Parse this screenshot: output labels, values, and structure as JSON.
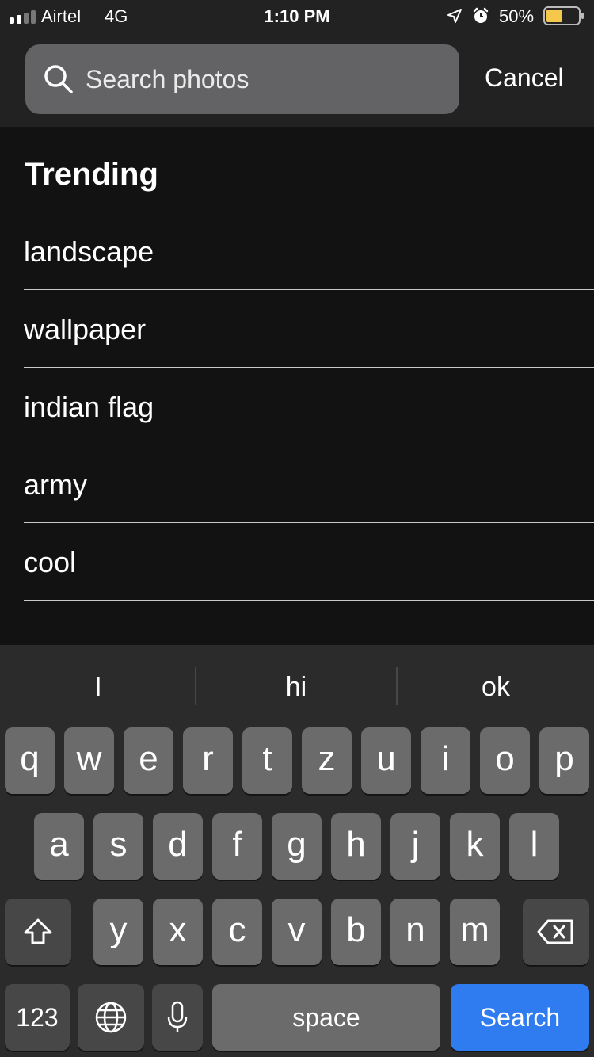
{
  "status_bar": {
    "carrier": "Airtel",
    "network": "4G",
    "time": "1:10 PM",
    "battery_percent": "50%",
    "battery_fill": 0.5,
    "battery_color": "#f5c84b",
    "signal_bars_filled": 2,
    "signal_bars_total": 4,
    "icons": [
      "signal-icon",
      "location-arrow-icon",
      "alarm-clock-icon",
      "battery-icon"
    ]
  },
  "search": {
    "placeholder": "Search photos",
    "value": "",
    "cancel_label": "Cancel"
  },
  "trending": {
    "title": "Trending",
    "items": [
      "landscape",
      "wallpaper",
      "indian flag",
      "army",
      "cool"
    ]
  },
  "keyboard": {
    "suggestions": [
      "I",
      "hi",
      "ok"
    ],
    "rows": [
      [
        "q",
        "w",
        "e",
        "r",
        "t",
        "z",
        "u",
        "i",
        "o",
        "p"
      ],
      [
        "a",
        "s",
        "d",
        "f",
        "g",
        "h",
        "j",
        "k",
        "l"
      ],
      [
        "y",
        "x",
        "c",
        "v",
        "b",
        "n",
        "m"
      ]
    ],
    "numbers_label": "123",
    "space_label": "space",
    "action_label": "Search",
    "action_color": "#2f7bf0",
    "icons": [
      "shift-icon",
      "backspace-icon",
      "globe-icon",
      "microphone-icon"
    ]
  }
}
